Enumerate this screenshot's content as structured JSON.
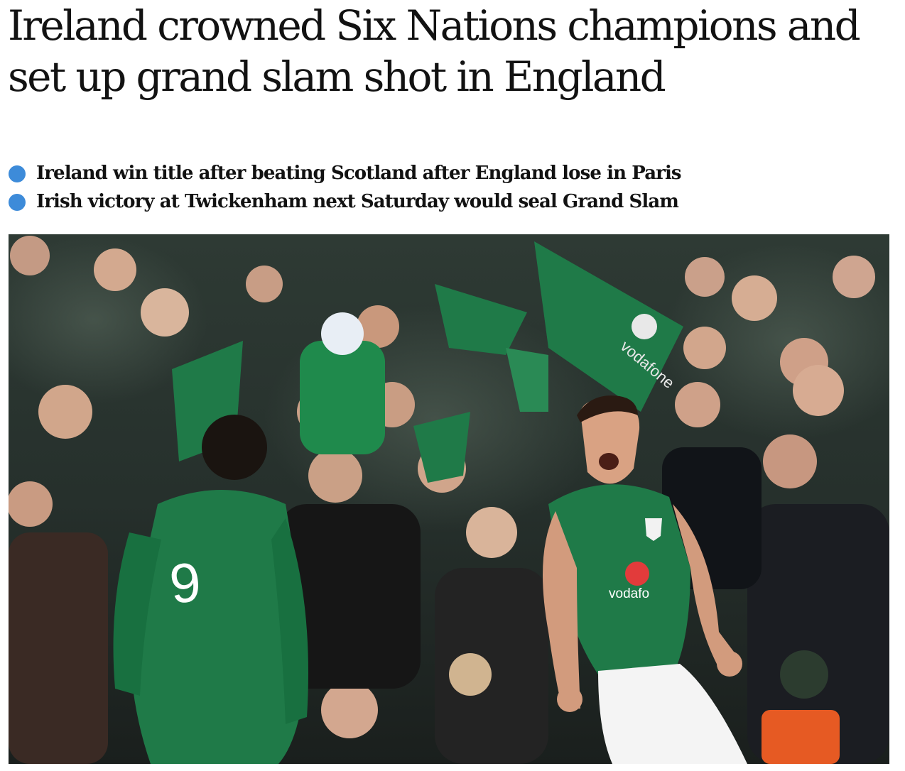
{
  "article": {
    "headline": "Ireland crowned Six Nations champions and set up grand slam shot in England",
    "standfirst": [
      "Ireland win title after beating Scotland after England lose in Paris",
      "Irish victory at Twickenham next Saturday would seal Grand Slam"
    ]
  },
  "photo": {
    "shirt_number": "9",
    "flag_sponsor": "vodafone",
    "shirt_sponsor": "vodafo"
  },
  "colors": {
    "bullet": "#3d8bd9",
    "text": "#121212",
    "irish_green": "#1f7a48"
  }
}
